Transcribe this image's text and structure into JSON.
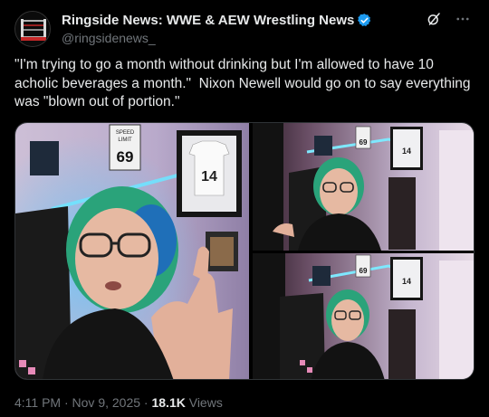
{
  "tweet": {
    "author": {
      "display_name": "Ringside News: WWE & AEW Wrestling News",
      "handle": "@ringsidenews_",
      "verified": true,
      "avatar_icon": "wrestling-ring-logo-icon"
    },
    "text": "\"I'm trying to go a month without drinking but I'm allowed to have 10 acholic beverages a month.\"  Nixon Newell would go on to say everything was \"blown out of portion.\"",
    "media": {
      "sign_label_1": "SPEED",
      "sign_label_2": "LIMIT",
      "sign_value": "69",
      "jersey_number": "14"
    },
    "timestamp": "4:11 PM · Nov 9, 2025 · ",
    "views_count": "18.1K",
    "views_label": " Views"
  },
  "colors": {
    "verified_blue": "#1d9bf0",
    "secondary_text": "#71767b",
    "primary_text": "#e7e9ea"
  }
}
